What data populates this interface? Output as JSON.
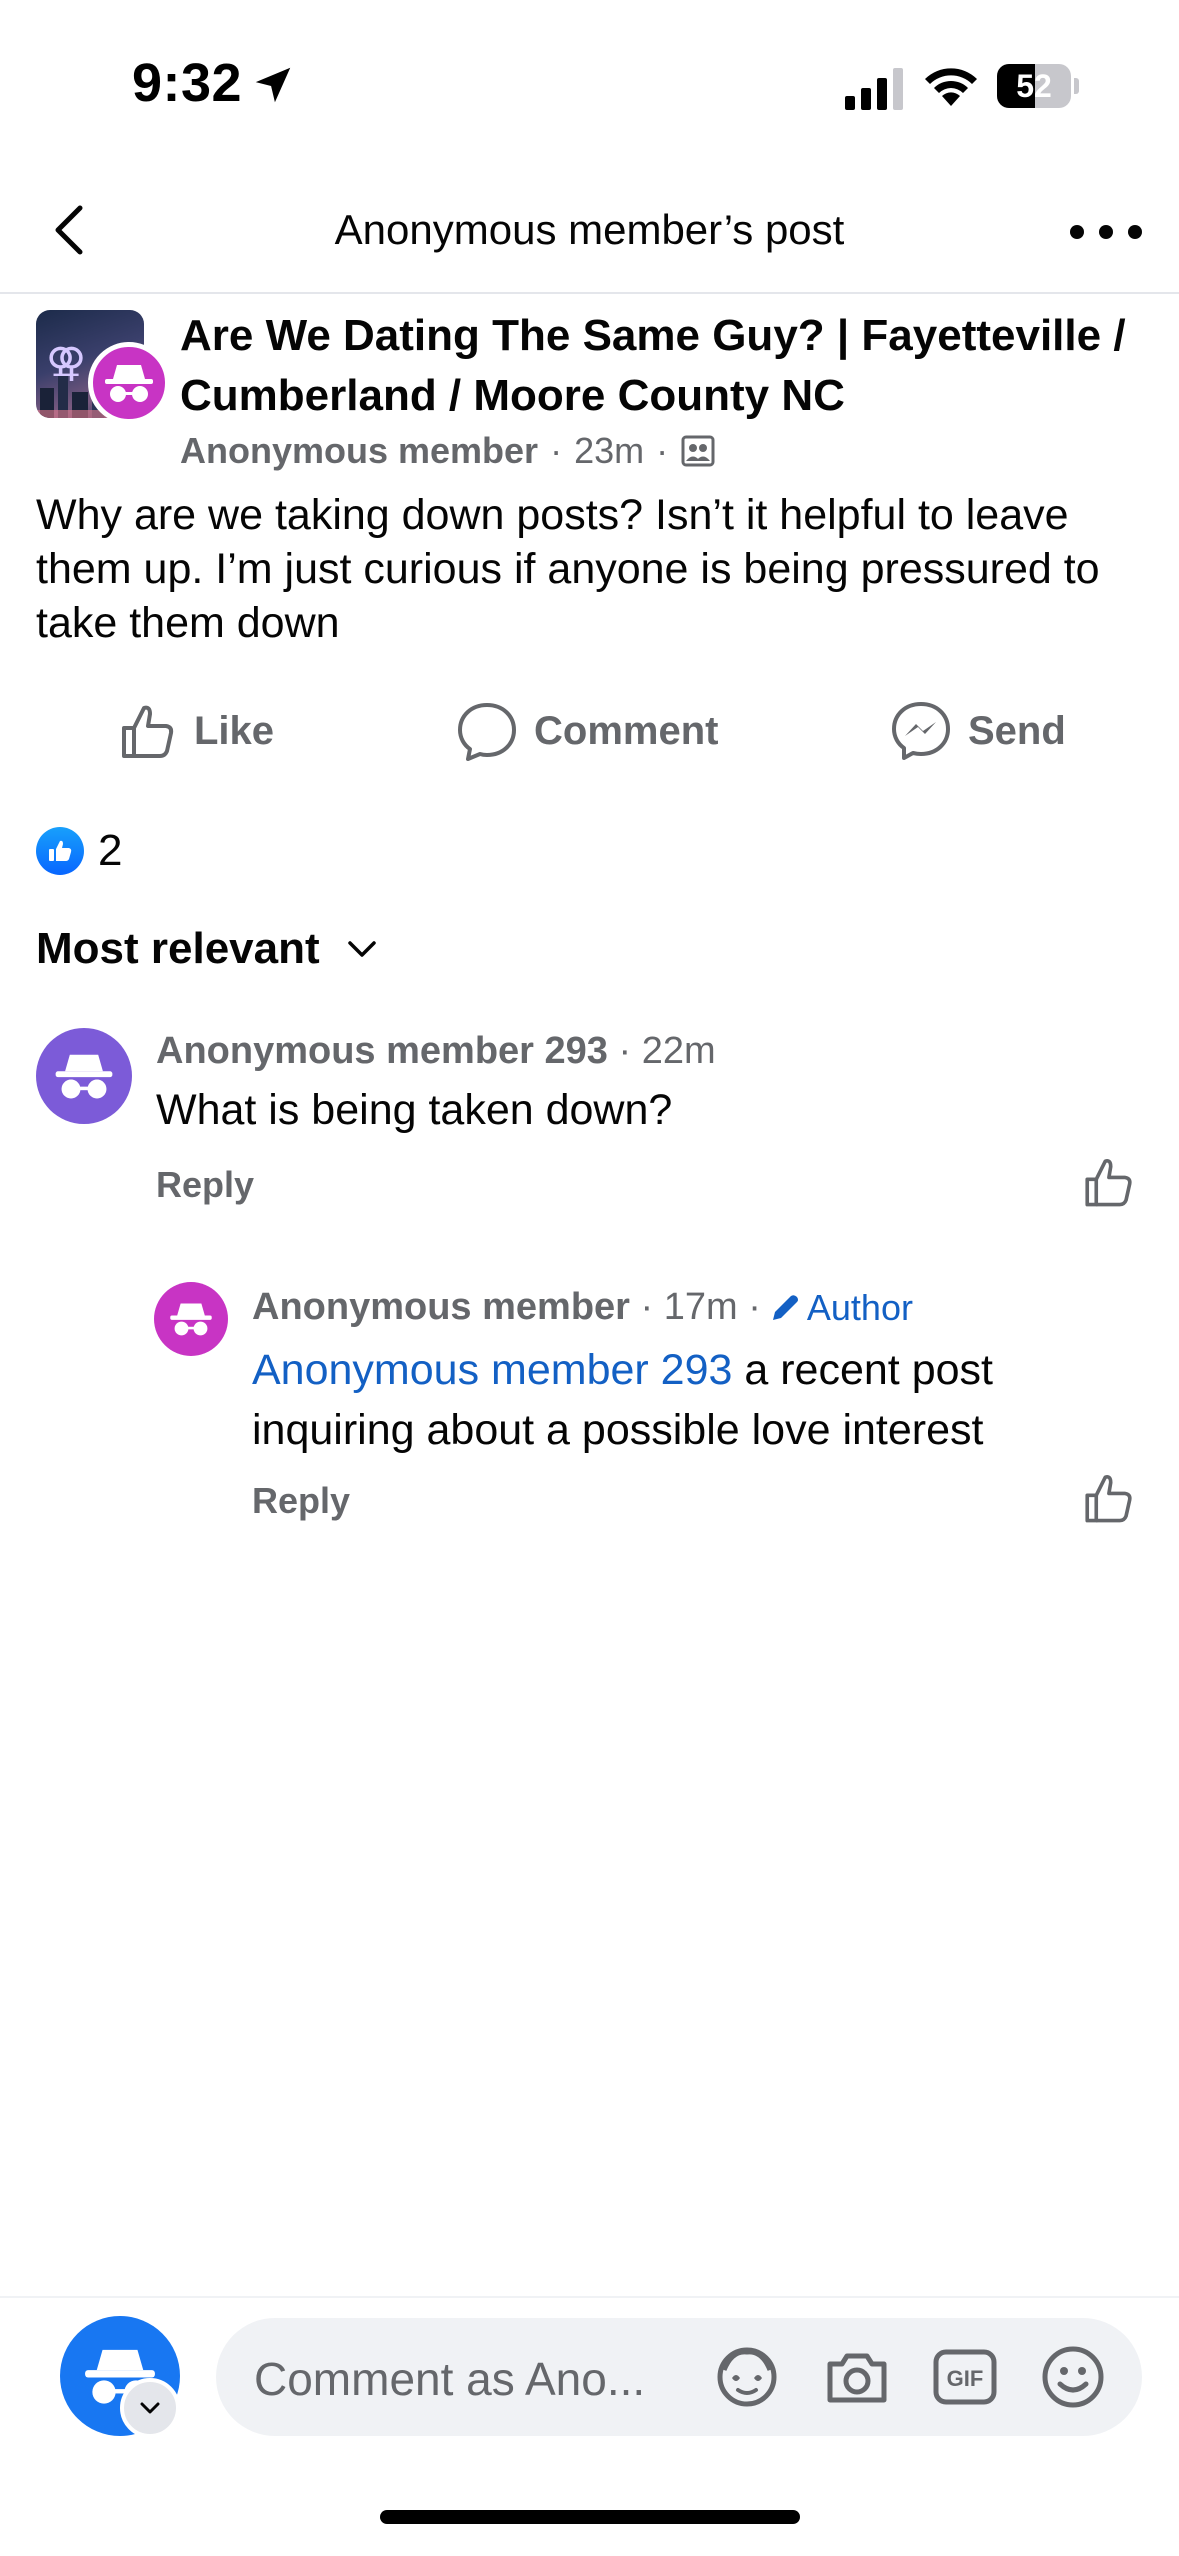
{
  "status_bar": {
    "time": "9:32",
    "battery_percent": "52",
    "battery_level": 0.52
  },
  "header": {
    "title": "Anonymous member’s post"
  },
  "post": {
    "group_name": "Are We Dating The Same Guy? | Fayetteville / Cumberland / Moore County NC",
    "author": "Anonymous member",
    "time": "23m",
    "body": "Why are we taking down posts? Isn’t it helpful to leave them up. I’m just curious if anyone is being pressured to take them down"
  },
  "actions": {
    "like": "Like",
    "comment": "Comment",
    "send": "Send"
  },
  "reactions": {
    "count": "2"
  },
  "sort": {
    "label": "Most relevant"
  },
  "comments": [
    {
      "author": "Anonymous member 293",
      "time": "22m",
      "text": "What is being taken down?",
      "reply_label": "Reply"
    },
    {
      "author": "Anonymous member",
      "time": "17m",
      "badge": "Author",
      "mention": "Anonymous member 293",
      "text": "a recent post inquiring about a possible love interest",
      "reply_label": "Reply"
    }
  ],
  "composer": {
    "placeholder": "Comment as Ano..."
  },
  "colors": {
    "accent_blue": "#1877f2",
    "link_blue": "#1360c4",
    "anon_purple": "#7c5bd8",
    "anon_magenta": "#c834c4",
    "secondary_text": "#65676b"
  }
}
